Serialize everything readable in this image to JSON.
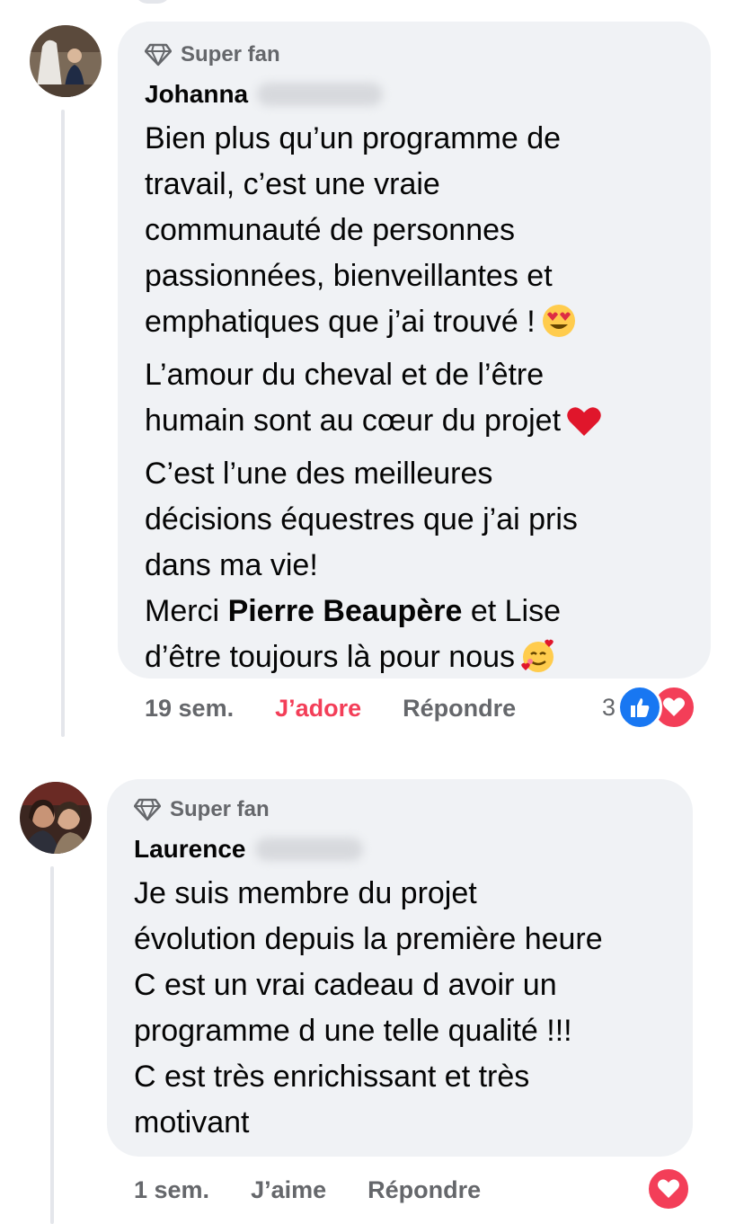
{
  "comments": [
    {
      "badge": "Super fan",
      "author": "Johanna",
      "text_parts": [
        "Bien plus qu’un programme de\ntravail, c’est une vraie\ncommunauté de personnes\npassionnées, bienveillantes et\nemphatiques que j’ai trouvé !",
        "\nL’amour du cheval et de l’être\nhumain sont au cœur du projet",
        "\nC’est l’une des meilleures\ndécisions équestres que j’ai pris\ndans ma vie!\nMerci ",
        "Pierre Beaupère",
        " et Lise\nd’être toujours là pour nous"
      ],
      "emojis": [
        "heart-eyes-emoji",
        "red-heart-emoji",
        "smiling-face-with-hearts-emoji"
      ],
      "time": "19 sem.",
      "reaction_action": "J’adore",
      "reply": "Répondre",
      "reaction_count": "3",
      "reactions": [
        "like",
        "love"
      ]
    },
    {
      "badge": "Super fan",
      "author": "Laurence",
      "text": "Je suis membre du projet\névolution depuis la première heure\nC est un vrai cadeau d avoir un\nprogramme d une telle qualité !!!\nC est très enrichissant et très\nmotivant",
      "time": "1 sem.",
      "reaction_action": "J’aime",
      "reply": "Répondre",
      "reactions": [
        "love"
      ]
    }
  ],
  "colors": {
    "bubble": "#f0f2f5",
    "secondary_text": "#65676b",
    "love": "#f33e58",
    "like": "#1877f2"
  }
}
